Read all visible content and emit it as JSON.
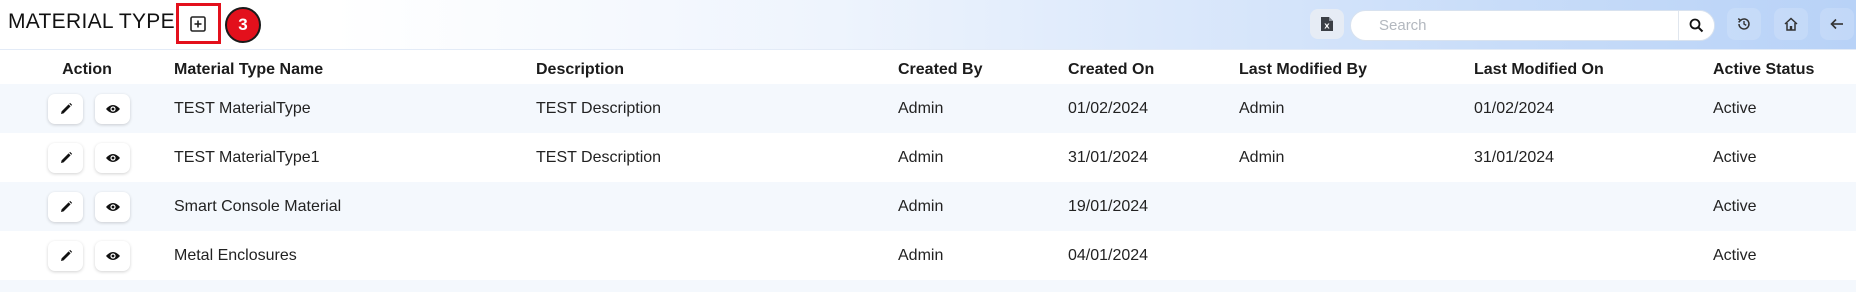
{
  "header": {
    "title": "MATERIAL TYPE",
    "step_badge": "3",
    "search_placeholder": "Search",
    "icons": [
      "add-box-icon",
      "excel-export-icon",
      "search-icon",
      "history-icon",
      "home-icon",
      "back-arrow-icon"
    ]
  },
  "colors": {
    "accent_red": "#e3101c",
    "header_gradient_end": "#b8d2f7",
    "row_stripe": "#f4f8fd"
  },
  "table": {
    "columns": [
      "Action",
      "Material Type Name",
      "Description",
      "Created By",
      "Created On",
      "Last Modified By",
      "Last Modified On",
      "Active Status"
    ],
    "rows": [
      [
        "TEST MaterialType",
        "TEST Description",
        "Admin",
        "01/02/2024",
        "Admin",
        "01/02/2024",
        "Active"
      ],
      [
        "TEST MaterialType1",
        "TEST Description",
        "Admin",
        "31/01/2024",
        "Admin",
        "31/01/2024",
        "Active"
      ],
      [
        "Smart Console Material",
        "",
        "Admin",
        "19/01/2024",
        "",
        "",
        "Active"
      ],
      [
        "Metal Enclosures",
        "",
        "Admin",
        "04/01/2024",
        "",
        "",
        "Active"
      ]
    ],
    "row_action_icons": [
      "edit-pencil-icon",
      "view-eye-icon"
    ]
  }
}
